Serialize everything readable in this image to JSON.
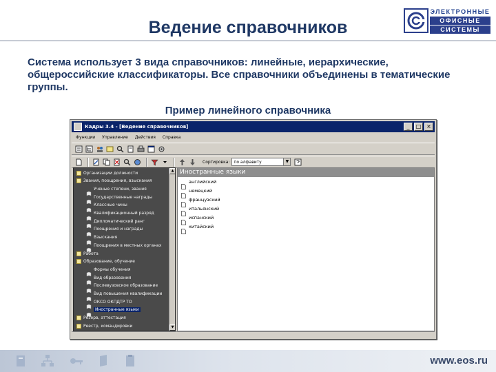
{
  "slide": {
    "title": "Ведение справочников",
    "intro": "Система использует 3 вида справочников: линейные, иерархические, общероссийские классификаторы. Все справочники объединены в тематические группы.",
    "example_caption": "Пример линейного справочника",
    "site": "www.eos.ru"
  },
  "logo": {
    "line1": "ЭЛЕКТРОННЫЕ",
    "line2": "ОФИСНЫЕ",
    "line3": "СИСТЕМЫ",
    "brand_color": "#2b3f8c"
  },
  "window": {
    "title": "Кадры 3.4 - [Ведение справочников]",
    "controls": {
      "minimize": "_",
      "maximize": "□",
      "close": "×"
    },
    "menu": [
      "Функции",
      "Управление",
      "Действия",
      "Справка"
    ],
    "sort_label": "Сортировка:",
    "sort_value": "по алфавиту",
    "tree": [
      {
        "label": "Организации должности",
        "indent": 0,
        "icon": "folder"
      },
      {
        "label": "Звания, поощрения, взыскания",
        "indent": 0,
        "icon": "folder"
      },
      {
        "label": "Ученые степени, звания",
        "indent": 1,
        "icon": "book"
      },
      {
        "label": "Государственные награды",
        "indent": 1,
        "icon": "book"
      },
      {
        "label": "Классные чины",
        "indent": 1,
        "icon": "book"
      },
      {
        "label": "Квалификационный разряд",
        "indent": 1,
        "icon": "book"
      },
      {
        "label": "Дипломатический ранг",
        "indent": 1,
        "icon": "book"
      },
      {
        "label": "Поощрения и награды",
        "indent": 1,
        "icon": "book"
      },
      {
        "label": "Взыскания",
        "indent": 1,
        "icon": "book"
      },
      {
        "label": "Поощрения в местных органах",
        "indent": 1,
        "icon": "book"
      },
      {
        "label": "Работа",
        "indent": 0,
        "icon": "folder"
      },
      {
        "label": "Образование, обучение",
        "indent": 0,
        "icon": "folder"
      },
      {
        "label": "Формы обучения",
        "indent": 1,
        "icon": "book"
      },
      {
        "label": "Вид образования",
        "indent": 1,
        "icon": "book"
      },
      {
        "label": "Послевузовское образование",
        "indent": 1,
        "icon": "book"
      },
      {
        "label": "Вид повышения квалификации",
        "indent": 1,
        "icon": "book"
      },
      {
        "label": "ОКСО ОКПДТР ТО",
        "indent": 1,
        "icon": "book"
      },
      {
        "label": "Иностранные языки",
        "indent": 1,
        "icon": "book",
        "selected": true
      },
      {
        "label": "Резерв, аттестация",
        "indent": 0,
        "icon": "folder"
      },
      {
        "label": "Реестр, командировки",
        "indent": 0,
        "icon": "folder"
      }
    ],
    "list_header": "Иностранные языки",
    "list": [
      "английский",
      "немецкий",
      "французский",
      "итальянский",
      "испанский",
      "китайский"
    ]
  }
}
